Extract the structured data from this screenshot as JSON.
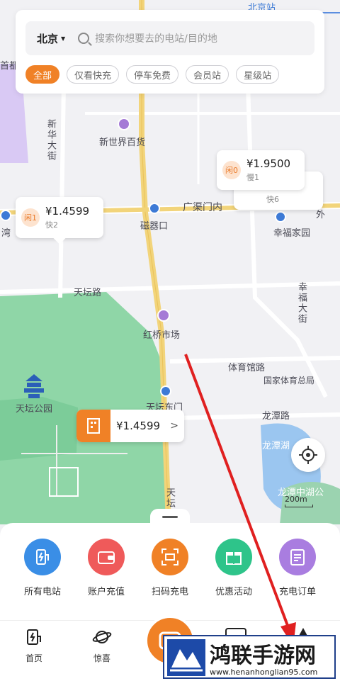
{
  "search": {
    "city": "北京",
    "placeholder": "搜索你想要去的电站/目的地"
  },
  "filters": [
    "全部",
    "仅看快充",
    "停车免费",
    "会员站",
    "星级站"
  ],
  "map_labels": {
    "north_station": "北京站",
    "capital": "首都",
    "xinhua_street": "新华大街",
    "xinshijie": "新世界百货",
    "guangqumen": "广渠门内",
    "ciqikou": "磁器口",
    "xingfu_home": "幸福家园",
    "tiantan_road": "天坛路",
    "hongqiao_market": "红桥市场",
    "xingfu_street": "幸福大街",
    "tiyuguan_road": "体育馆路",
    "sports_bureau": "国家体育总局",
    "tiantan_park": "天坛公园",
    "tiantan_east_gate": "天坛东门",
    "longtan_road": "龙潭路",
    "longtan_lake": "龙潭湖",
    "longtan_middle_lake": "龙潭中湖公",
    "tian": "天坛",
    "wan": "湾",
    "wai": "外",
    "scale": "200m"
  },
  "pins": [
    {
      "idle": "闲0",
      "price": "¥1.9500",
      "sub": "慢1"
    },
    {
      "idle": "闲1",
      "price": "¥1.4599",
      "sub": "快2"
    },
    {
      "sub": "快6"
    }
  ],
  "featured_pin": {
    "price": "¥1.4599",
    "arrow": ">"
  },
  "quick_actions": [
    {
      "label": "所有电站",
      "color": "#3a8ee6",
      "icon": "station-icon"
    },
    {
      "label": "账户充值",
      "color": "#ef5a5a",
      "icon": "wallet-icon"
    },
    {
      "label": "扫码充电",
      "color": "#f08126",
      "icon": "scan-icon"
    },
    {
      "label": "优惠活动",
      "color": "#2ec48a",
      "icon": "gift-icon"
    },
    {
      "label": "充电订单",
      "color": "#a97de0",
      "icon": "order-icon"
    }
  ],
  "tabs": [
    {
      "label": "首页",
      "icon": "charger-icon"
    },
    {
      "label": "惊喜",
      "icon": "planet-icon"
    }
  ],
  "watermark": {
    "title": "鸿联手游网",
    "url": "www.henanhonglian95.com"
  },
  "colors": {
    "accent": "#f08126",
    "arrow": "#e02020"
  }
}
